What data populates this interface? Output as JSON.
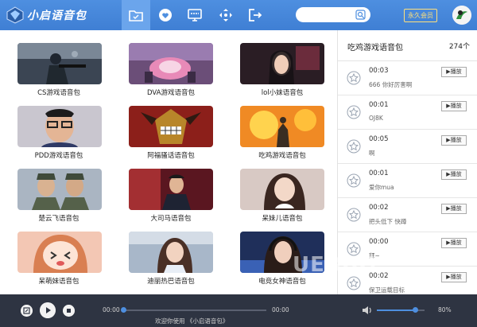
{
  "app": {
    "title": "小启语音包",
    "vip_label": "永久会员"
  },
  "colors": {
    "topbar": "#4e8fe0",
    "player": "#2e3442",
    "accent": "#4e8fe0"
  },
  "nav": [
    {
      "name": "folder-icon",
      "active": true
    },
    {
      "name": "heart-icon",
      "active": false
    },
    {
      "name": "monitor-icon",
      "active": false
    },
    {
      "name": "move-icon",
      "active": false
    },
    {
      "name": "exit-icon",
      "active": false
    }
  ],
  "search": {
    "placeholder": ""
  },
  "cards": [
    {
      "label": "CS游戏语音包",
      "art": "soldier"
    },
    {
      "label": "DVA游戏语音包",
      "art": "mech"
    },
    {
      "label": "lol小妹语音包",
      "art": "girl-dark"
    },
    {
      "label": "PDD游戏语音包",
      "art": "man-glasses"
    },
    {
      "label": "阿福骚话语音包",
      "art": "anime-villain"
    },
    {
      "label": "吃鸡游戏语音包",
      "art": "explosion"
    },
    {
      "label": "楚云飞语音包",
      "art": "officers"
    },
    {
      "label": "大司马语音包",
      "art": "man-suit"
    },
    {
      "label": "呆妹儿语音包",
      "art": "girl-light"
    },
    {
      "label": "呆萌妹语音包",
      "art": "anime-girl"
    },
    {
      "label": "迪丽热巴语音包",
      "art": "celebrity"
    },
    {
      "label": "电竞女神语音包",
      "art": "esports-girl"
    }
  ],
  "panel": {
    "title": "吃鸡游戏语音包",
    "count": "274个",
    "play_label": "▶播放",
    "items": [
      {
        "time": "00:03",
        "text": "666 你好厉害啊"
      },
      {
        "time": "00:01",
        "text": "OJ8K"
      },
      {
        "time": "00:05",
        "text": "啊"
      },
      {
        "time": "00:01",
        "text": "爱你mua"
      },
      {
        "time": "00:02",
        "text": "把头低下 快蹲"
      },
      {
        "time": "00:00",
        "text": "拜~"
      },
      {
        "time": "00:02",
        "text": "保卫运载目标"
      }
    ]
  },
  "player": {
    "time_current": "00:00",
    "time_total": "00:00",
    "progress": 0,
    "now_playing": "欢迎你使用 《小启语音包》",
    "volume_text": "80%",
    "volume": 0.8
  },
  "watermark": "UEBUG"
}
